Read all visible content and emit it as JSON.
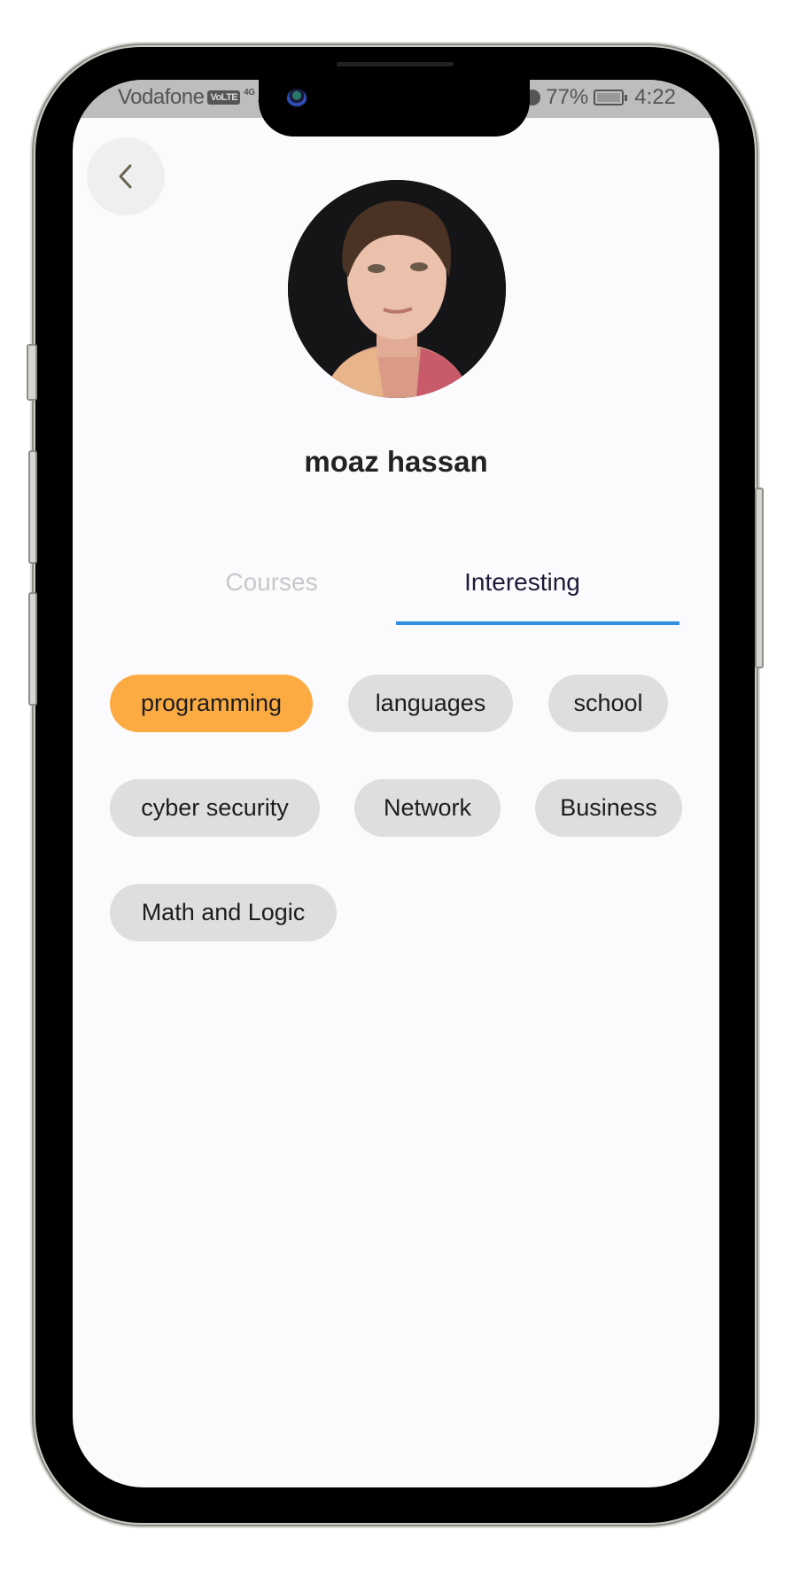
{
  "status_bar": {
    "carrier": "Vodafone",
    "volte_badge": "VoLTE",
    "network": "4G",
    "battery_percent": "77%",
    "time": "4:22"
  },
  "header": {
    "back_icon": "chevron-left-icon"
  },
  "profile": {
    "name": "moaz hassan",
    "avatar_alt": "profile photo"
  },
  "tabs": [
    {
      "label": "Courses",
      "active": false
    },
    {
      "label": "Interesting",
      "active": true
    }
  ],
  "interests": [
    {
      "label": "programming",
      "selected": true
    },
    {
      "label": "languages",
      "selected": false
    },
    {
      "label": "school",
      "selected": false
    },
    {
      "label": "cyber security",
      "selected": false
    },
    {
      "label": "Network",
      "selected": false
    },
    {
      "label": "Business",
      "selected": false
    },
    {
      "label": "Math and Logic",
      "selected": false
    }
  ],
  "colors": {
    "accent_selected": "#fcab42",
    "chip_default": "#dedede",
    "tab_underline": "#2f8fe0",
    "tab_active_text": "#1b1b38",
    "tab_inactive_text": "#c8c8cc"
  }
}
